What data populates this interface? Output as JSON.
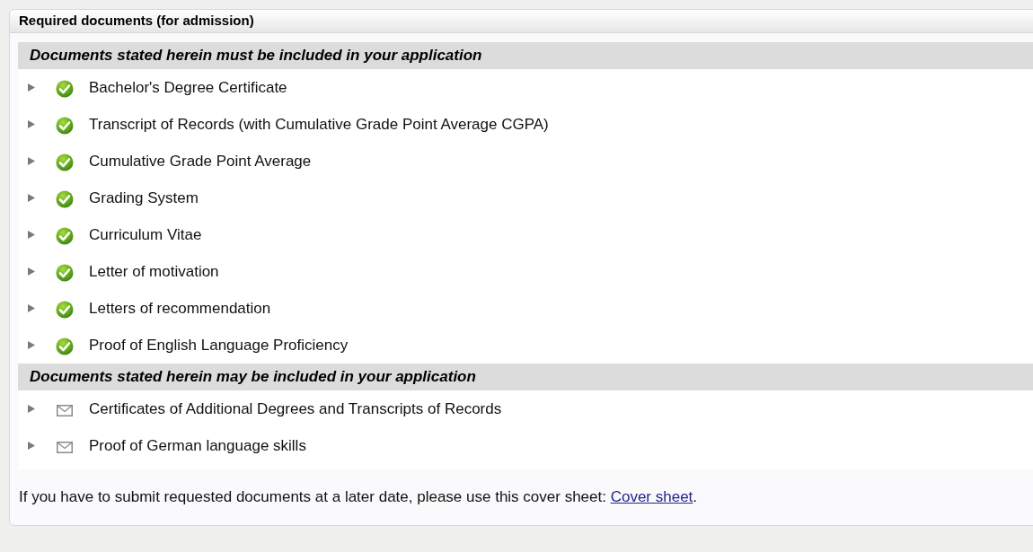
{
  "panel": {
    "title": "Required documents (for admission)"
  },
  "sections": [
    {
      "heading": "Documents stated herein must be included in your application",
      "items": [
        {
          "label": "Bachelor's Degree Certificate",
          "kind": "check",
          "expanded": false
        },
        {
          "label": "Transcript of Records (with Cumulative Grade Point Average CGPA)",
          "kind": "check",
          "expanded": false
        },
        {
          "label": "Cumulative Grade Point Average",
          "kind": "check",
          "expanded": false
        },
        {
          "label": "Grading System",
          "kind": "check",
          "expanded": false
        },
        {
          "label": "Curriculum Vitae",
          "kind": "check",
          "expanded": false
        },
        {
          "label": "Letter of motivation",
          "kind": "check",
          "expanded": false
        },
        {
          "label": "Letters of recommendation",
          "kind": "check",
          "expanded": false
        },
        {
          "label": "Proof of English Language Proficiency",
          "kind": "check",
          "expanded": false
        }
      ]
    },
    {
      "heading": "Documents stated herein may be included in your application",
      "items": [
        {
          "label": "Certificates of Additional Degrees and Transcripts of Records",
          "kind": "mail",
          "expanded": false
        },
        {
          "label": "Proof of German language skills",
          "kind": "mail",
          "expanded": false
        }
      ]
    }
  ],
  "footer": {
    "text": "If you have to submit requested documents at a later date, please use this cover sheet: ",
    "link": "Cover sheet",
    "after": "."
  }
}
